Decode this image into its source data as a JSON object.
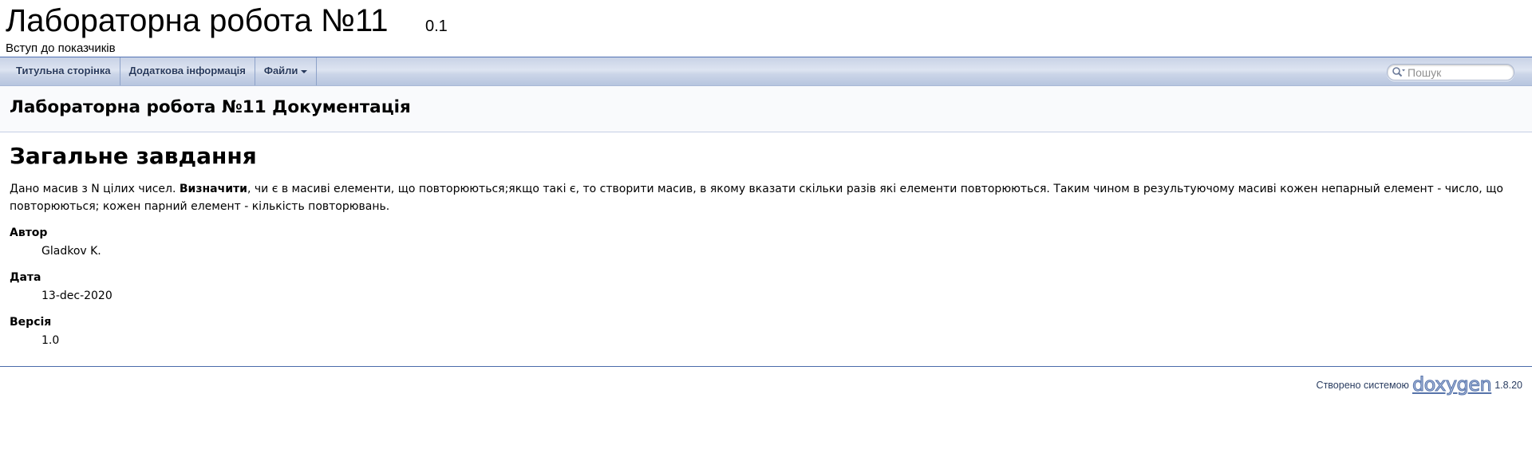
{
  "project": {
    "name": "Лабораторна робота №11",
    "number": "0.1",
    "brief": "Вступ до показчиків"
  },
  "nav": {
    "items": [
      {
        "label": "Титульна сторінка"
      },
      {
        "label": "Додаткова інформація"
      },
      {
        "label": "Файли"
      }
    ],
    "search_placeholder": "Пошук"
  },
  "header": {
    "title": "Лабораторна робота №11 Документація"
  },
  "main": {
    "heading": "Загальне завдання",
    "paragraph": {
      "before": "Дано масив з N цілих чисел. ",
      "bold": "Визначити",
      "after": ", чи є в масиві елементи, що повторюються;якщо такі є, то створити масив, в якому вказати скільки разів які елементи повторюються. Таким чином в результуючому масиві кожен непарный елемент - число, що повторюються; кожен парний елемент - кількість повторювань."
    },
    "sections": [
      {
        "title": "Автор",
        "value": "Gladkov K."
      },
      {
        "title": "Дата",
        "value": "13-dec-2020"
      },
      {
        "title": "Версія",
        "value": "1.0"
      }
    ]
  },
  "footer": {
    "generated_by": "Створено системою",
    "logo_text": "doxygen",
    "version": "1.8.20"
  },
  "colors": {
    "nav_text": "#283A5D",
    "footer_rule": "#4A6AAA",
    "header_bg": "#F9FAFC"
  }
}
